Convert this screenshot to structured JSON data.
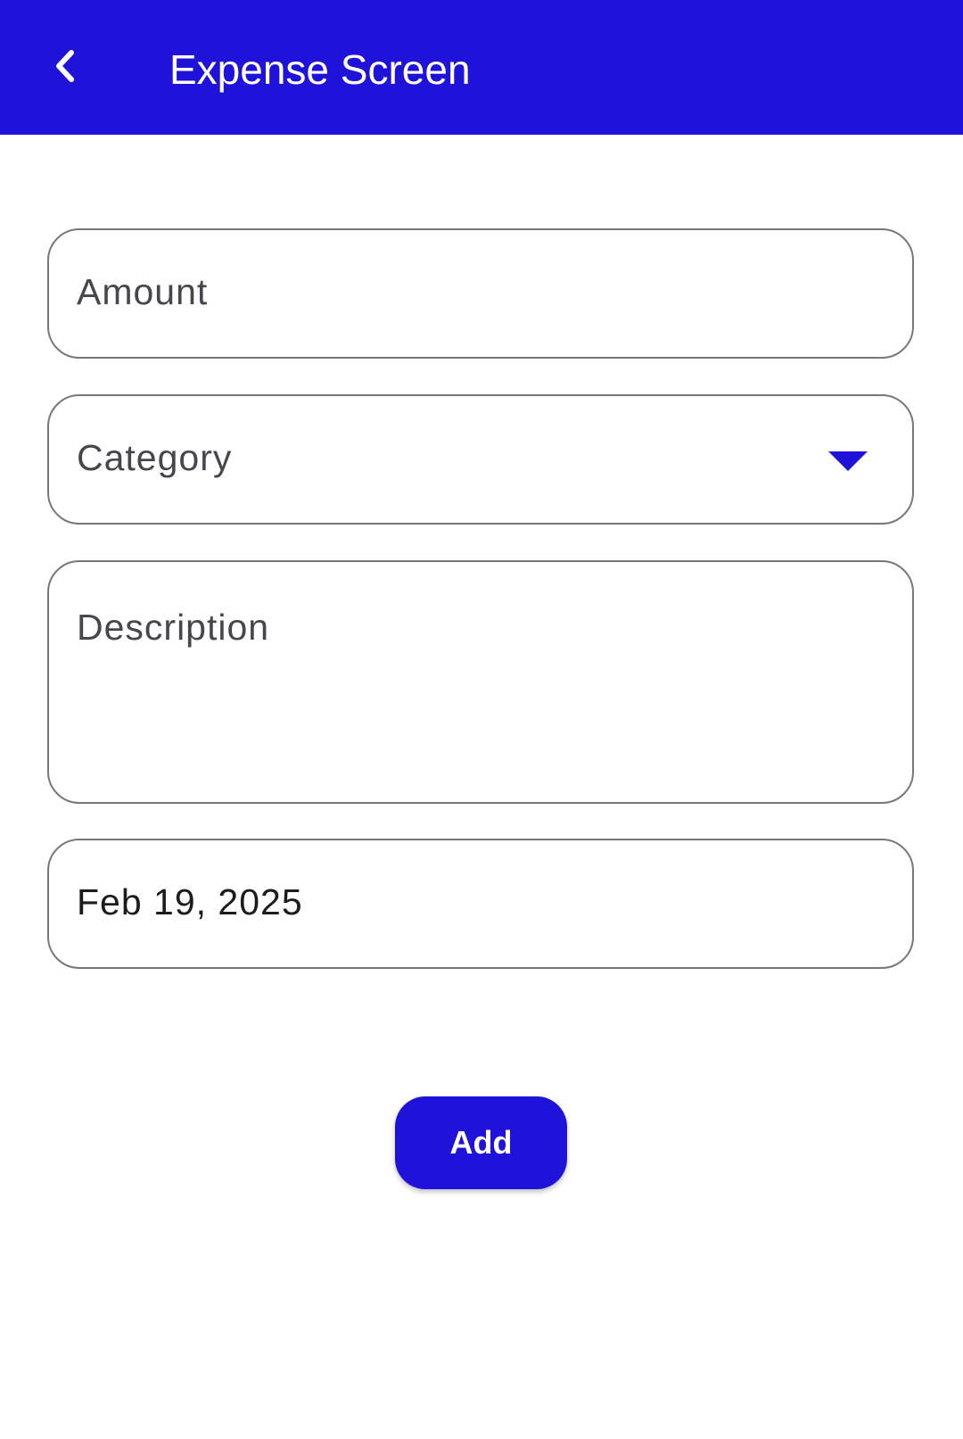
{
  "colors": {
    "primary": "#2013d9",
    "on_primary": "#ffffff",
    "outline": "#79767d",
    "label_text": "#49454f",
    "value_text": "#1c1b1f"
  },
  "app_bar": {
    "back_icon": "chevron-left-icon",
    "title": "Expense Screen"
  },
  "form": {
    "amount": {
      "label": "Amount",
      "value": ""
    },
    "category": {
      "label": "Category",
      "selected": "",
      "icon": "dropdown-arrow-icon"
    },
    "description": {
      "label": "Description",
      "value": ""
    },
    "date": {
      "value": "Feb 19, 2025"
    }
  },
  "actions": {
    "add_label": "Add"
  }
}
